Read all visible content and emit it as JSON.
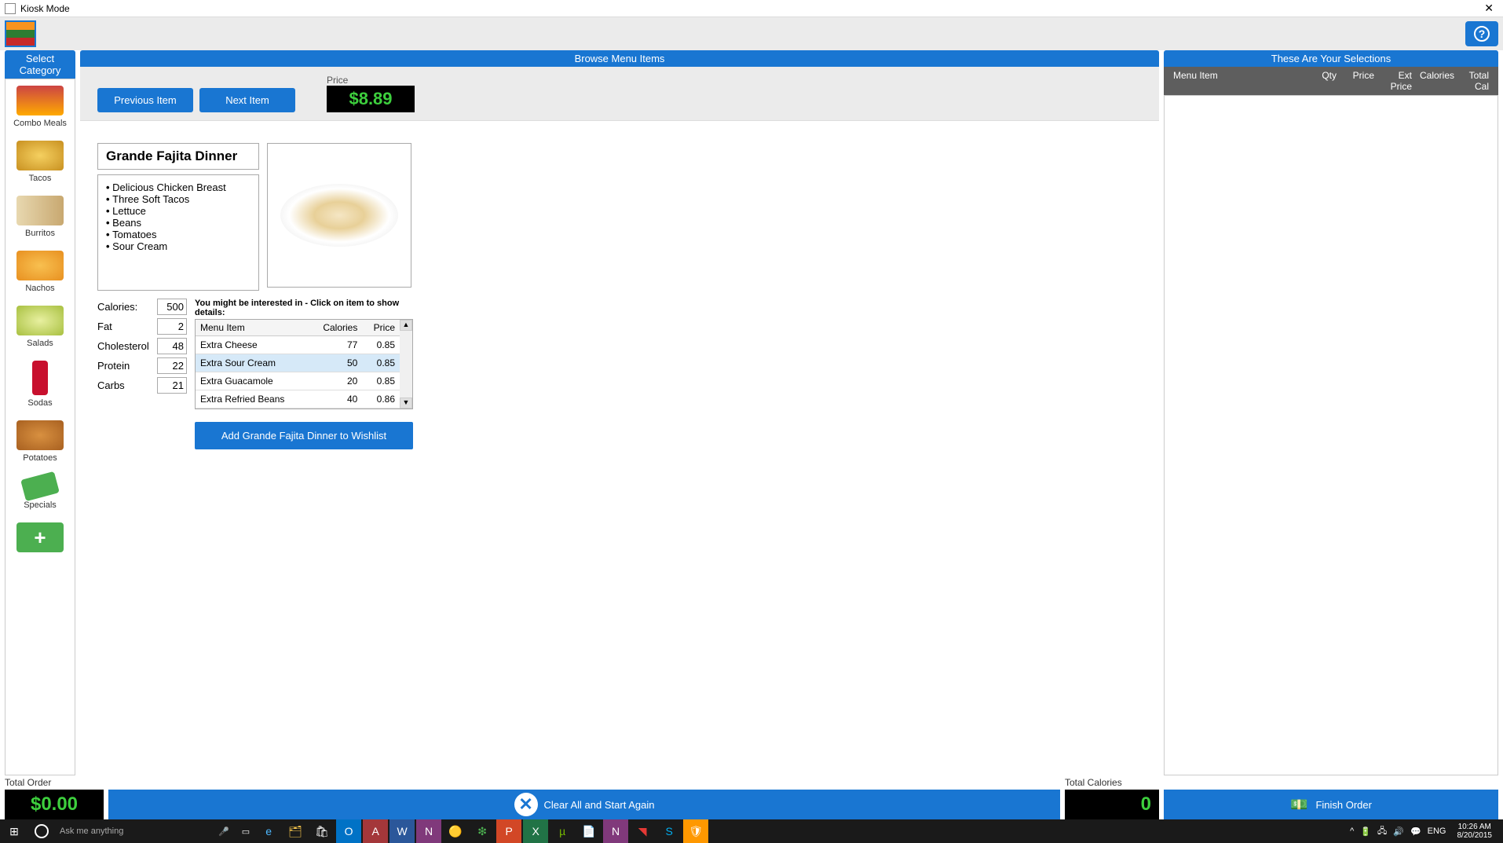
{
  "window": {
    "title": "Kiosk Mode"
  },
  "headers": {
    "category": "Select Category",
    "browse": "Browse Menu Items",
    "selections": "These Are Your Selections"
  },
  "nav": {
    "prev": "Previous Item",
    "next": "Next Item",
    "price_label": "Price",
    "price": "$8.89"
  },
  "categories": [
    {
      "label": "Combo Meals",
      "thumb": "thumb-combo"
    },
    {
      "label": "Tacos",
      "thumb": "thumb-taco"
    },
    {
      "label": "Burritos",
      "thumb": "thumb-burrito"
    },
    {
      "label": "Nachos",
      "thumb": "thumb-nachos"
    },
    {
      "label": "Salads",
      "thumb": "thumb-salads"
    },
    {
      "label": "Sodas",
      "thumb": "thumb-sodas"
    },
    {
      "label": "Potatoes",
      "thumb": "thumb-potatoes"
    },
    {
      "label": "Specials",
      "thumb": "thumb-specials"
    },
    {
      "label": "",
      "thumb": "thumb-add"
    }
  ],
  "item": {
    "name": "Grande Fajita Dinner",
    "ingredients": [
      "Delicious Chicken Breast",
      "Three Soft Tacos",
      "Lettuce",
      "Beans",
      "Tomatoes",
      "Sour Cream"
    ]
  },
  "nutri_labels": {
    "calories": "Calories:",
    "fat": "Fat",
    "cholesterol": "Cholesterol",
    "protein": "Protein",
    "carbs": "Carbs"
  },
  "nutrition": {
    "calories": "500",
    "fat": "2",
    "cholesterol": "48",
    "protein": "22",
    "carbs": "21"
  },
  "addons": {
    "hint": "You might be interested in - Click on item to show details:",
    "cols": {
      "item": "Menu Item",
      "cal": "Calories",
      "price": "Price"
    },
    "rows": [
      {
        "item": "Extra Cheese",
        "cal": "77",
        "price": "0.85"
      },
      {
        "item": "Extra Sour Cream",
        "cal": "50",
        "price": "0.85"
      },
      {
        "item": "Extra Guacamole",
        "cal": "20",
        "price": "0.85"
      },
      {
        "item": "Extra Refried Beans",
        "cal": "40",
        "price": "0.86"
      }
    ],
    "selected_index": 1,
    "add_btn": "Add Grande Fajita Dinner to Wishlist"
  },
  "selections": {
    "cols": {
      "item": "Menu Item",
      "qty": "Qty",
      "price": "Price",
      "ext": "Ext Price",
      "cal": "Calories",
      "tot": "Total Cal"
    }
  },
  "totals": {
    "order_label": "Total Order",
    "order_value": "$0.00",
    "calories_label": "Total Calories",
    "calories_value": "0",
    "clear": "Clear All and Start Again",
    "finish": "Finish Order"
  },
  "taskbar": {
    "search_placeholder": "Ask me anything",
    "lang": "ENG",
    "time": "10:26 AM",
    "date": "8/20/2015"
  }
}
